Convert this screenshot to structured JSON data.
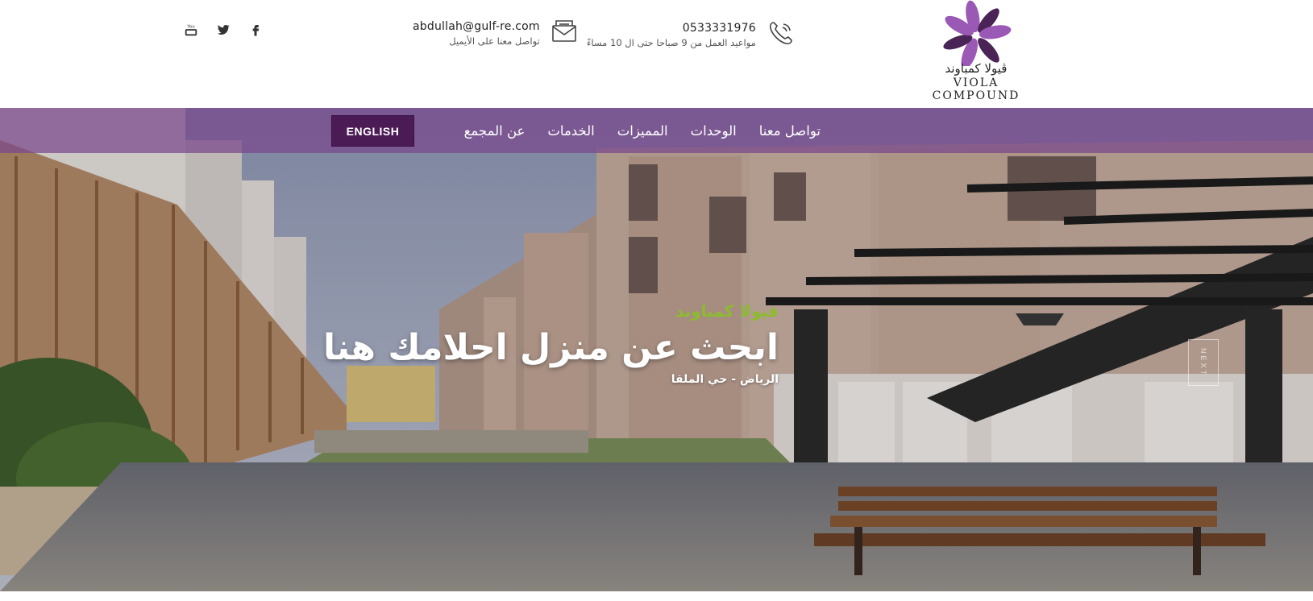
{
  "social": {
    "youtube_icon": "youtube-icon",
    "twitter_icon": "twitter-icon",
    "facebook_icon": "facebook-icon"
  },
  "contact": {
    "email": "abdullah@gulf-re.com",
    "email_note": "تواصل معنا على الأيميل",
    "phone": "0533331976",
    "phone_note": "مواعيد العمل من 9 صباحا حتى ال 10 مساءً"
  },
  "logo": {
    "arabic": "ڤيولا كمباوند",
    "english": "VIOLA COMPOUND",
    "color": "#9b59b6"
  },
  "nav": {
    "items": [
      "عن المجمع",
      "الخدمات",
      "المميزات",
      "الوحدات",
      "تواصل معنا"
    ],
    "lang_button": "ENGLISH",
    "bar_color": "#7a468c"
  },
  "hero": {
    "subtitle": "فيولا كمباوند",
    "title": "ابحث عن منزل احلامك هنا",
    "location": "الرياض - حي الملقا",
    "next_label": "NEXT",
    "subtitle_color": "#8dbb2f"
  }
}
